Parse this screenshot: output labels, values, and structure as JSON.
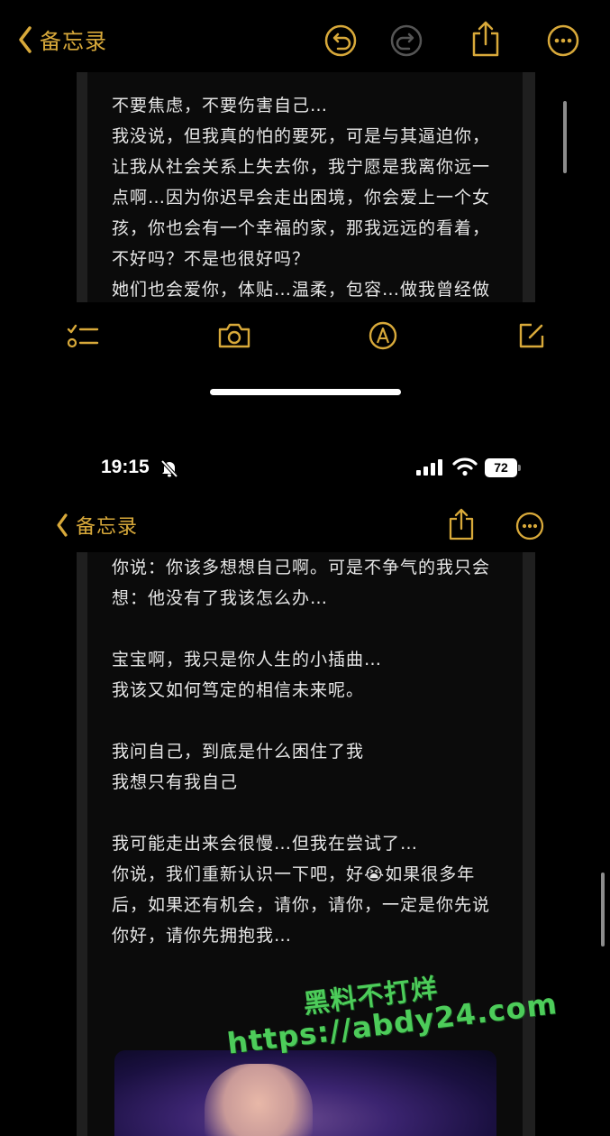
{
  "top_screen": {
    "nav": {
      "back_label": "备忘录"
    },
    "note_lines": [
      "不要焦虑，不要伤害自己…",
      "我没说，但我真的怕的要死，可是与其逼迫你，",
      "让我从社会关系上失去你，我宁愿是我离你远一",
      "点啊…因为你迟早会走出困境，你会爱上一个女",
      "孩，你也会有一个幸福的家，那我远远的看着，",
      "不好吗？不是也很好吗？",
      "她们也会爱你，体贴…温柔，包容…做我曾经做"
    ]
  },
  "status_bar": {
    "time": "19:15",
    "battery": "72"
  },
  "bottom_screen": {
    "nav": {
      "back_label": "备忘录"
    },
    "note_lines": [
      "你说：你该多想想自己啊。可是不争气的我只会",
      "想：他没有了我该怎么办…",
      "",
      "宝宝啊，我只是你人生的小插曲…",
      "我该又如何笃定的相信未来呢。",
      "",
      "我问自己，到底是什么困住了我",
      "我想只有我自己",
      "",
      "我可能走出来会很慢…但我在尝试了…",
      "你说，我们重新认识一下吧，好😭如果很多年",
      "后，如果还有机会，请你，请你，一定是你先说",
      "你好，请你先拥抱我…"
    ]
  },
  "watermark": {
    "line1": "黑料不打烊",
    "line2": "https://abdy24.com"
  },
  "colors": {
    "accent": "#d8a93a",
    "watermark": "#4dcc5a"
  }
}
